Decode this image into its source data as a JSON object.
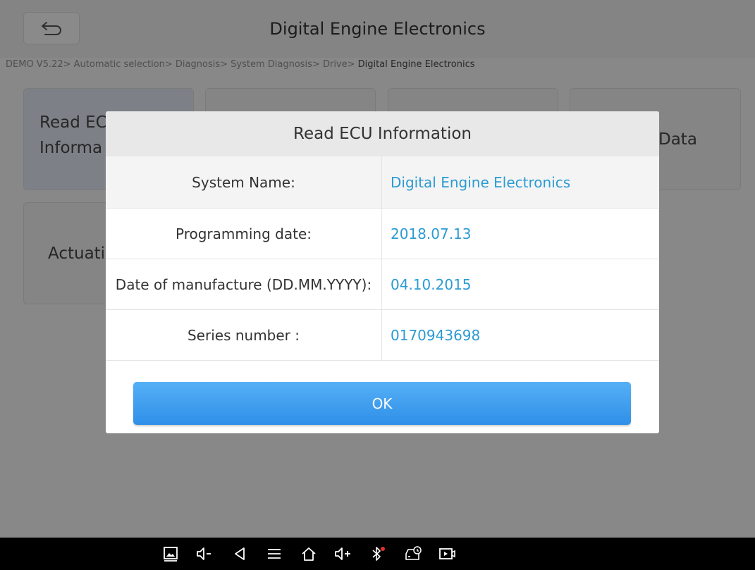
{
  "header": {
    "title": "Digital Engine Electronics",
    "back_icon": "back-arrow-icon"
  },
  "breadcrumb": {
    "path": "DEMO V5.22> Automatic selection> Diagnosis> System Diagnosis> Drive> ",
    "current": "Digital Engine Electronics"
  },
  "tiles": [
    {
      "label_line1": "Read EC",
      "label_line2": "Informa"
    },
    {
      "label_line1": "Data"
    },
    {
      "label_line1": "Actuati"
    }
  ],
  "dialog": {
    "title": "Read ECU Information",
    "rows": [
      {
        "label": "System Name:",
        "value": "Digital Engine Electronics"
      },
      {
        "label": "Programming date:",
        "value": "2018.07.13"
      },
      {
        "label": "Date of manufacture (DD.MM.YYYY):",
        "value": "04.10.2015"
      },
      {
        "label": "Series number :",
        "value": "0170943698"
      }
    ],
    "ok_label": "OK"
  },
  "navbar": {
    "icons": [
      "screenshot-icon",
      "volume-down-icon",
      "back-icon",
      "menu-icon",
      "home-icon",
      "volume-up-icon",
      "bluetooth-icon",
      "vci-car-icon",
      "screen-record-icon"
    ]
  },
  "colors": {
    "value_text": "#2b9bd3",
    "ok_button": "#3d9cee"
  }
}
